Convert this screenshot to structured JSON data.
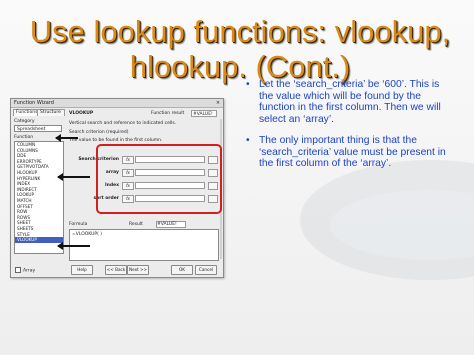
{
  "slide": {
    "title_line1": "Use lookup functions: vlookup,",
    "title_line2": "hlookup. (Cont.)",
    "bullets": [
      "Let the ‘search_criteria’ be ‘600’. This is the value which will be found by the function in the first column. Then we will select an ‘array’.",
      "The only important thing is that the ‘search_criteria’ value must be present in the first column of the ‘array’."
    ],
    "bullet_symbol": "•",
    "colors": {
      "title": "#d98b1a",
      "bullet_text": "#1b43c8",
      "highlight": "#d02020"
    }
  },
  "dialog": {
    "title": "Function Wizard",
    "close": "×",
    "tabs": [
      "Functions",
      "Structure"
    ],
    "category_label": "Category",
    "category_value": "Spreadsheet",
    "function_label": "Function",
    "functions": [
      "COLUMN",
      "COLUMNS",
      "DDE",
      "ERRORTYPE",
      "GETPIVOTDATA",
      "HLOOKUP",
      "HYPERLINK",
      "INDEX",
      "INDIRECT",
      "LOOKUP",
      "MATCH",
      "OFFSET",
      "ROW",
      "ROWS",
      "SHEET",
      "SHEETS",
      "STYLE",
      "VLOOKUP"
    ],
    "selected_function": "VLOOKUP",
    "function_name": "VLOOKUP",
    "function_result_label": "Function result",
    "function_result_value": "#VALUE!",
    "description": "Vertical search and reference to indicated cells.",
    "arg_description": "Search criterion (required)",
    "arg_description2": "The value to be found in the first column.",
    "args": [
      {
        "label": "Search criterion",
        "fx": "fx"
      },
      {
        "label": "array",
        "fx": "fx"
      },
      {
        "label": "Index",
        "fx": "fx"
      },
      {
        "label": "sort order",
        "fx": "fx"
      }
    ],
    "formula_label": "Formula",
    "result_label": "Result",
    "result_value": "#VALUE!",
    "formula_text": "=VLOOKUP( )",
    "array_label": "Array",
    "buttons": [
      "Help",
      "<< Back",
      "Next >>",
      "OK",
      "Cancel"
    ]
  }
}
